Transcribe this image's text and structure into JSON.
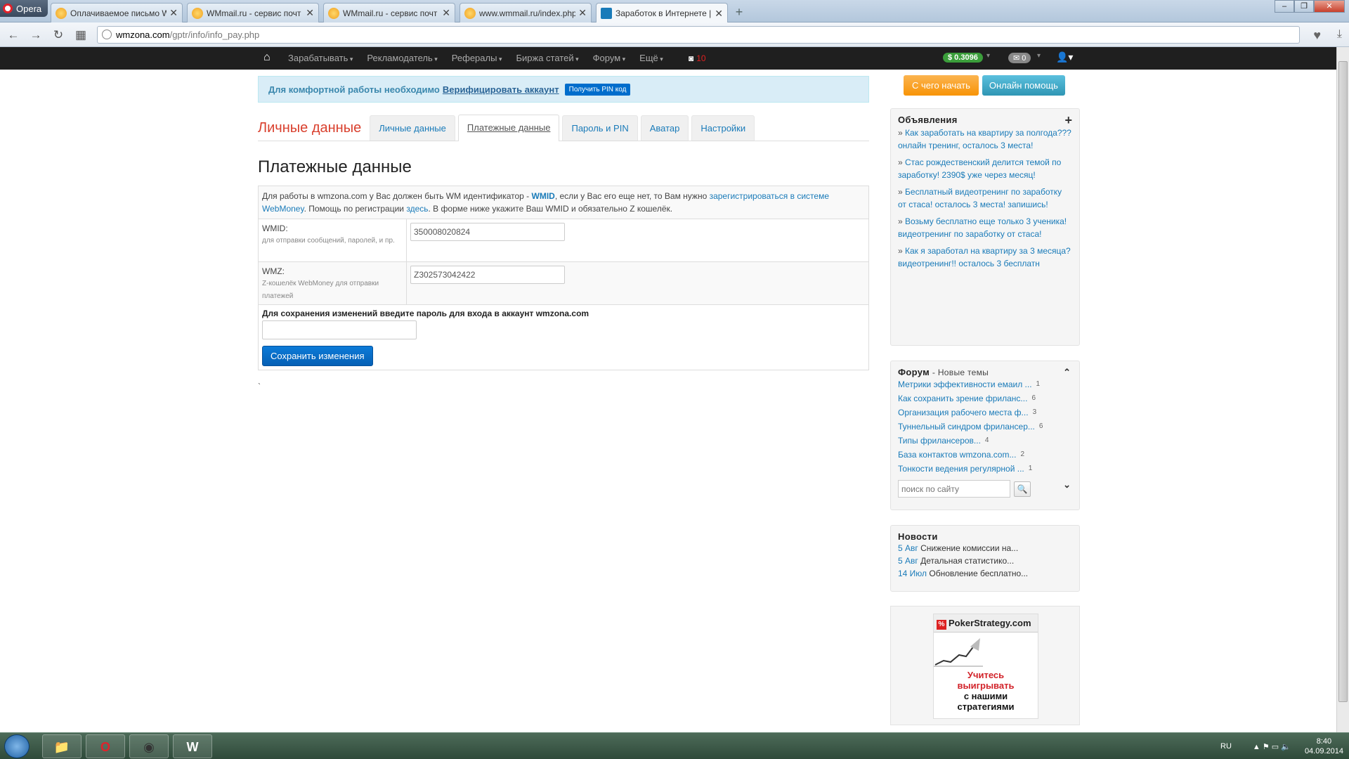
{
  "browser": {
    "opera_label": "Opera",
    "tabs": [
      {
        "title": "Оплачиваемое письмо W",
        "close": "✕"
      },
      {
        "title": "WMmail.ru - сервис почт",
        "close": "✕"
      },
      {
        "title": "WMmail.ru - сервис почт",
        "close": "✕"
      },
      {
        "title": "www.wmmail.ru/index.php",
        "close": "✕"
      },
      {
        "title": "Заработок в Интернете | ",
        "close": "✕"
      }
    ],
    "url_host": "wmzona.com",
    "url_path": "/gptr/info/info_pay.php"
  },
  "sitenav": {
    "menu": [
      "Зарабатывать",
      "Рекламодатель",
      "Рефералы",
      "Биржа статей",
      "Форум",
      "Ещё"
    ],
    "notif_count": "10",
    "balance": "$ 0.3096",
    "mail_count": "0"
  },
  "alert": {
    "text": "Для комфортной работы необходимо",
    "link": "Верифицировать аккаунт",
    "pin_button": "Получить PIN код"
  },
  "profile_tabs": {
    "title": "Личные данные",
    "items": [
      "Личные данные",
      "Платежные данные",
      "Пароль и PIN",
      "Аватар",
      "Настройки"
    ]
  },
  "page_title": "Платежные данные",
  "form": {
    "intro_1": "Для работы в wmzona.com у Вас должен быть WM идентификатор - ",
    "intro_wmid": "WMID",
    "intro_2": ", если у Вас его еще нет, то Вам нужно ",
    "intro_reg_link": "зарегистрироваться в системе WebMoney",
    "intro_3": ". Помощь по регистрации ",
    "intro_here": "здесь",
    "intro_4": ". В форме ниже укажите Ваш WMID и обязательно Z кошелёк.",
    "wmid_label": "WMID:",
    "wmid_sub": "для отправки сообщений, паролей, и пр.",
    "wmid_value": "350008020824",
    "wmz_label": "WMZ:",
    "wmz_sub": "Z-кошелёк WebMoney для отправки платежей",
    "wmz_value": "Z302573042422",
    "save_prompt": "Для сохранения изменений введите пароль для входа в аккаунт wmzona.com",
    "save_button": "Сохранить изменения",
    "tick": "`"
  },
  "sidebar": {
    "start_button": "С чего начать",
    "help_button": "Онлайн помощь",
    "ads_title": "Объявления",
    "ads": [
      "Как заработать на квартиру за полгода??? онлайн тренинг, осталось 3 места!",
      "Стас рождественский делится темой по заработку! 2390$ уже через месяц!",
      "Бесплатный видеотренинг по заработку от стаса! осталось 3 места! запишись!",
      "Возьму бесплатно еще только 3 ученика! видеотренинг по заработку от стаса!",
      "Как я заработал на квартиру за 3 месяца? видеотренинг!! осталось 3 бесплатн"
    ],
    "forum_title": "Форум",
    "forum_sub": "- Новые темы",
    "forum_topics": [
      {
        "title": "Метрики эффективности емаил ...",
        "count": "1"
      },
      {
        "title": "Как сохранить зрение фриланс...",
        "count": "6"
      },
      {
        "title": "Организация рабочего места ф...",
        "count": "3"
      },
      {
        "title": "Туннельный синдром фрилансер...",
        "count": "6"
      },
      {
        "title": "Типы фрилансеров...",
        "count": "4"
      },
      {
        "title": "База контактов wmzona.com...",
        "count": "2"
      },
      {
        "title": "Тонкости ведения регулярной ...",
        "count": "1"
      }
    ],
    "search_placeholder": "поиск по сайту",
    "news_title": "Новости",
    "news": [
      {
        "date": "5 Авг",
        "text": "Снижение комиссии на..."
      },
      {
        "date": "5 Авг",
        "text": "Детальная статистико..."
      },
      {
        "date": "14 Июл",
        "text": "Обновление бесплатно..."
      }
    ],
    "banner_brand": "PokerStrategy.com",
    "banner_line1": "Учитесь",
    "banner_line2": "выигрывать",
    "banner_line3": "с нашими",
    "banner_line4": "стратегиями"
  },
  "taskbar": {
    "lang": "RU",
    "time": "8:40",
    "date": "04.09.2014"
  }
}
